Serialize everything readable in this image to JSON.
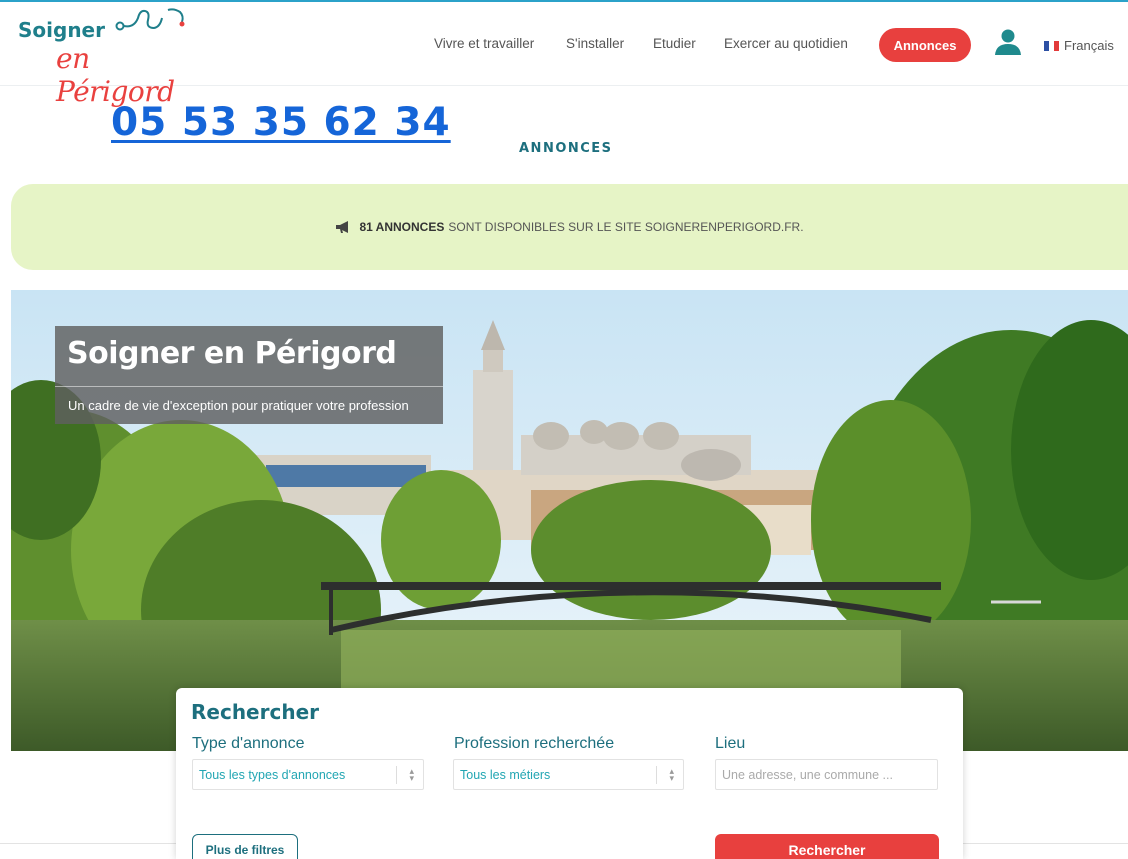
{
  "brand": {
    "logo_line1": "Soigner",
    "logo_line2": "en Périgord",
    "accent_teal": "#1d6f7e",
    "accent_red": "#e8403e",
    "link_blue": "#1565d8"
  },
  "nav": {
    "items": [
      "Vivre et travailler",
      "S'installer",
      "Etudier",
      "Exercer au quotidien"
    ],
    "cta_label": "Annonces",
    "user_icon": "user-icon",
    "language": "Français",
    "language_flag": "flag-fr-icon"
  },
  "phone": "05 53 35 62 34",
  "page_title": "ANNONCES",
  "notice": {
    "icon": "megaphone-icon",
    "count_label": "81 ANNONCES",
    "text": "SONT DISPONIBLES SUR LE SITE SOIGNERENPERIGORD.FR."
  },
  "hero": {
    "title": "Soigner en Périgord",
    "subtitle": "Un cadre de vie d'exception pour pratiquer votre profession"
  },
  "search": {
    "title": "Rechercher",
    "fields": [
      {
        "label": "Type d'annonce",
        "value": "Tous les types d'annonces"
      },
      {
        "label": "Profession recherchée",
        "value": "Tous les métiers"
      },
      {
        "label": "Lieu",
        "placeholder": "Une adresse, une commune ..."
      }
    ],
    "more_filters_label": "Plus de filtres",
    "submit_label": "Rechercher"
  }
}
